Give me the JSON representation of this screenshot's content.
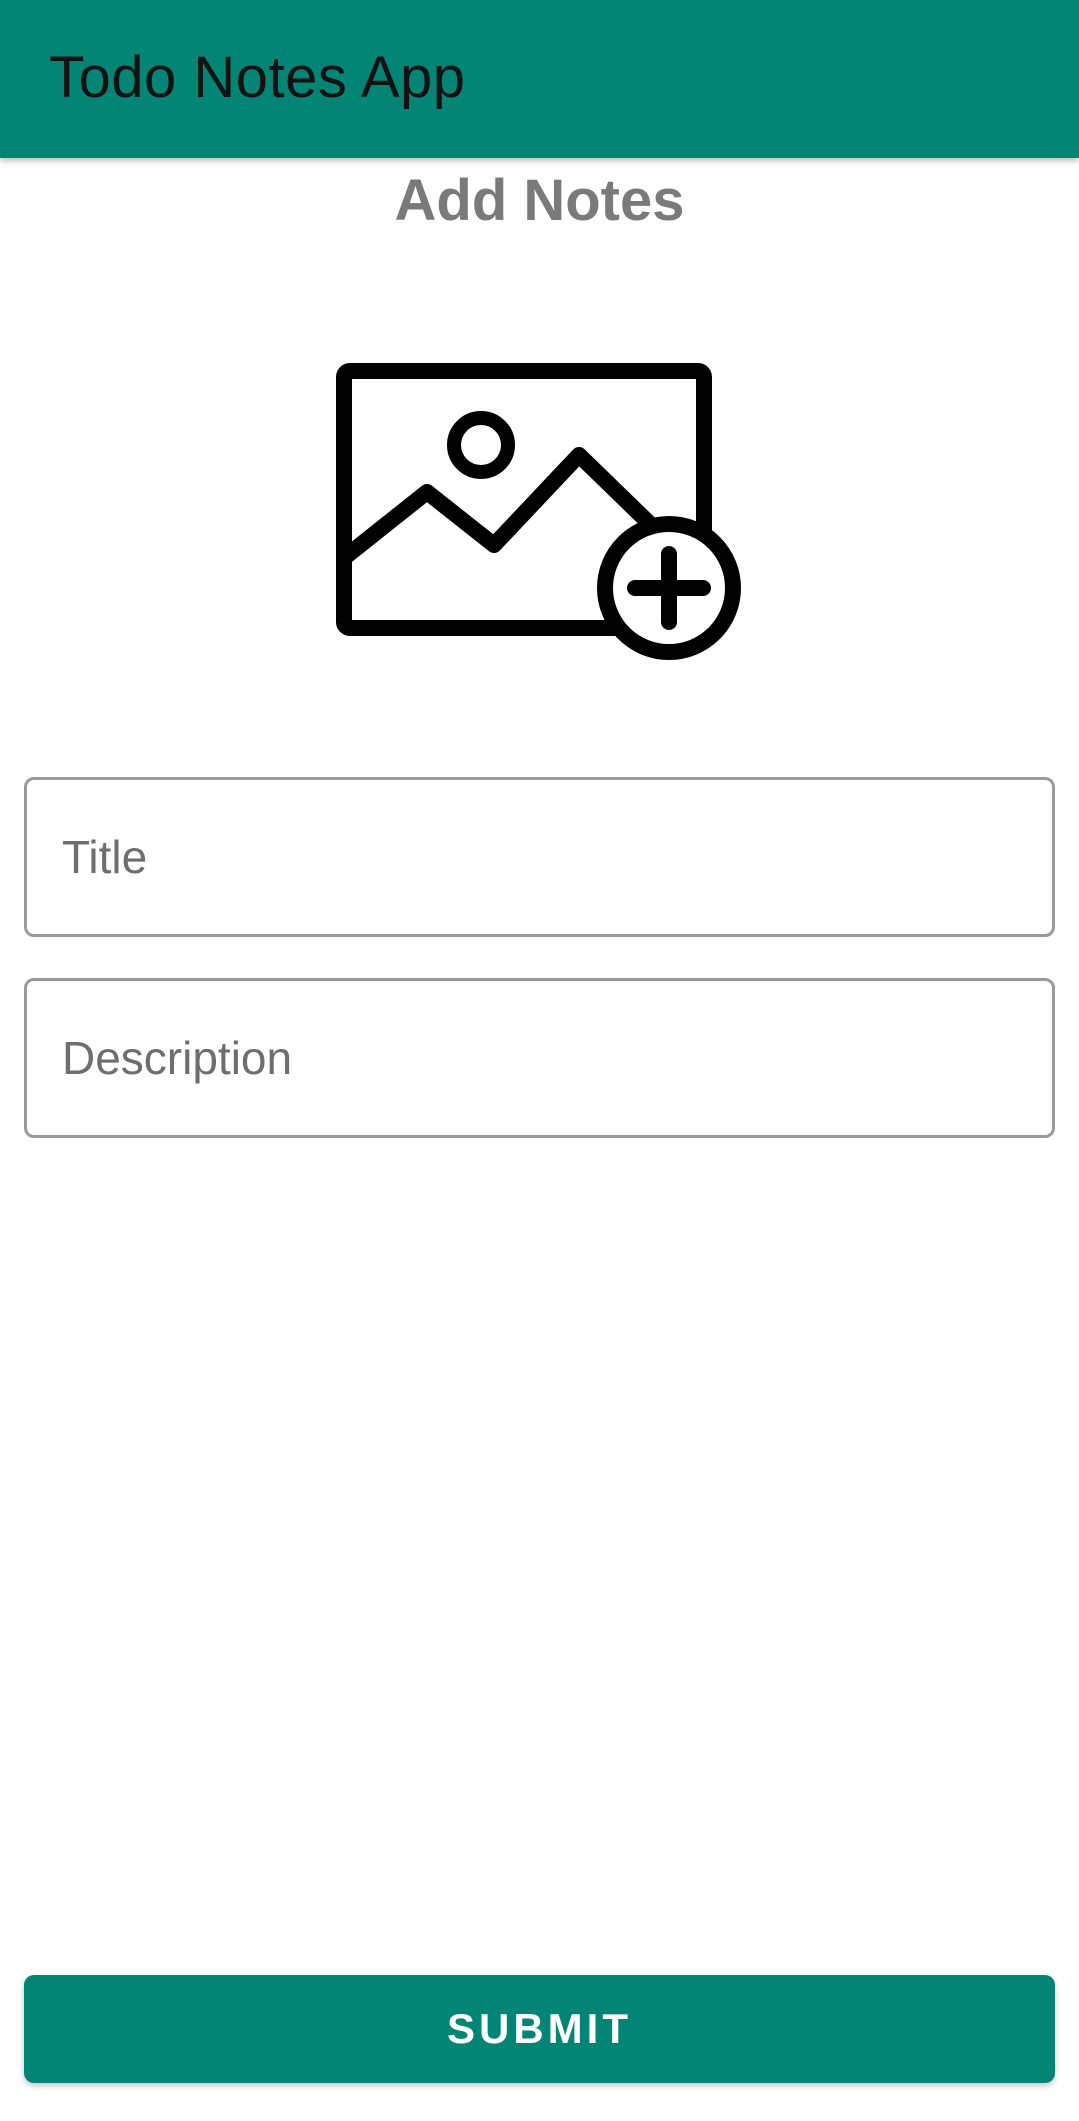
{
  "app_bar": {
    "title": "Todo Notes App",
    "color": "#028574"
  },
  "page": {
    "heading": "Add Notes"
  },
  "image_picker": {
    "icon": "add-photo-icon"
  },
  "form": {
    "title_placeholder": "Title",
    "title_value": "",
    "description_placeholder": "Description",
    "description_value": ""
  },
  "actions": {
    "submit_label": "SUBMIT",
    "accent": "#028574"
  }
}
